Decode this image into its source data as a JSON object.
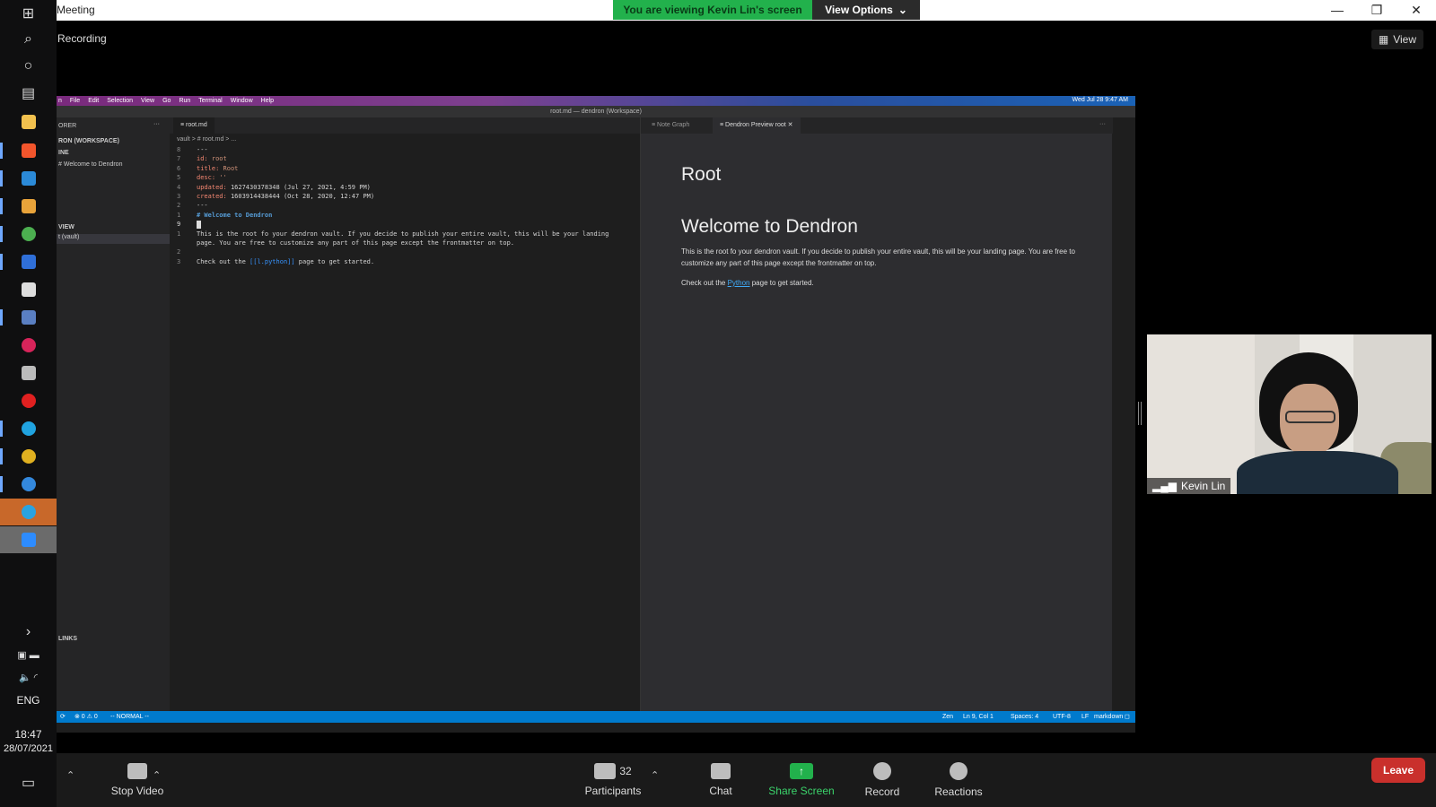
{
  "window": {
    "title": "Meeting",
    "banner": "You are viewing Kevin Lin's screen",
    "view_options": "View Options",
    "recording": "Recording",
    "view_label": "View"
  },
  "taskbar": {
    "language": "ENG",
    "time": "18:47",
    "date": "28/07/2021",
    "icons": [
      "windows-start-icon",
      "search-icon",
      "cortana-icon",
      "task-view-icon",
      "file-explorer-icon",
      "brave-icon",
      "vscode-icon",
      "git-icon",
      "chrome-icon",
      "app-icon",
      "inkscape-icon",
      "document-icon",
      "debian-icon",
      "tool-icon",
      "opera-icon",
      "skype-icon",
      "chrome-icon-2",
      "app-icon-2",
      "telegram-icon",
      "zoom-icon"
    ]
  },
  "vscode": {
    "menu": [
      "File",
      "Edit",
      "Selection",
      "View",
      "Go",
      "Run",
      "Terminal",
      "Window",
      "Help"
    ],
    "mac_datetime": "Wed Jul 28 9:47 AM",
    "titlebar": "root.md — dendron (Workspace)",
    "sidebar": {
      "explorer": "ORER",
      "workspace": "RON (WORKSPACE)",
      "outline": "INE",
      "outline_item": "# Welcome to Dendron",
      "tree_view": "VIEW",
      "tree_item": "t (vault)",
      "backlinks": "LINKS"
    },
    "tab": "root.md",
    "breadcrumb": "vault > # root.md > ...",
    "code": [
      {
        "ln": "8",
        "text": "---"
      },
      {
        "ln": "7",
        "key": "id:",
        "val": "root"
      },
      {
        "ln": "6",
        "key": "title:",
        "val": "Root"
      },
      {
        "ln": "5",
        "key": "desc:",
        "val": "''"
      },
      {
        "ln": "4",
        "key": "updated:",
        "val": "1627430378348 (Jul 27, 2021, 4:59 PM)"
      },
      {
        "ln": "3",
        "key": "created:",
        "val": "1603914438444 (Oct 28, 2020, 12:47 PM)"
      },
      {
        "ln": "2",
        "text": "---"
      },
      {
        "ln": "1",
        "heading": "# Welcome to Dendron"
      },
      {
        "ln": "9",
        "text": ""
      },
      {
        "ln": "1",
        "text": "This is the root fo your dendron vault. If you decide to publish your entire vault, this will be your landing"
      },
      {
        "ln": "",
        "text": "page. You are free to customize any part of this page except the frontmatter on top."
      },
      {
        "ln": "2",
        "text": ""
      },
      {
        "ln": "3",
        "pre": "Check out the ",
        "link": "[[l.python]]",
        "post": " page to get started."
      }
    ],
    "preview": {
      "tab_graph": "Note Graph",
      "tab_preview": "Dendron Preview root",
      "h1": "Root",
      "h2": "Welcome to Dendron",
      "p1": "This is the root fo your dendron vault. If you decide to publish your entire vault, this will be your landing page. You are free to customize any part of this page except the frontmatter on top.",
      "p2_pre": "Check out the ",
      "p2_link": "Python",
      "p2_post": " page to get started."
    },
    "status": {
      "errors": "⊗ 0 ⚠ 0",
      "mode": "-- NORMAL --",
      "zen": "Zen",
      "position": "Ln 9, Col 1",
      "spaces": "Spaces: 4",
      "encoding": "UTF-8",
      "eol": "LF",
      "language": "markdown"
    }
  },
  "video": {
    "name": "Kevin Lin"
  },
  "controls": {
    "stop_video": "Stop Video",
    "participants": "Participants",
    "participants_count": "32",
    "chat": "Chat",
    "share_screen": "Share Screen",
    "record": "Record",
    "reactions": "Reactions",
    "leave": "Leave"
  },
  "colors": {
    "banner_green": "#22b14c",
    "vscode_blue": "#007acc",
    "leave_red": "#c9302c"
  }
}
